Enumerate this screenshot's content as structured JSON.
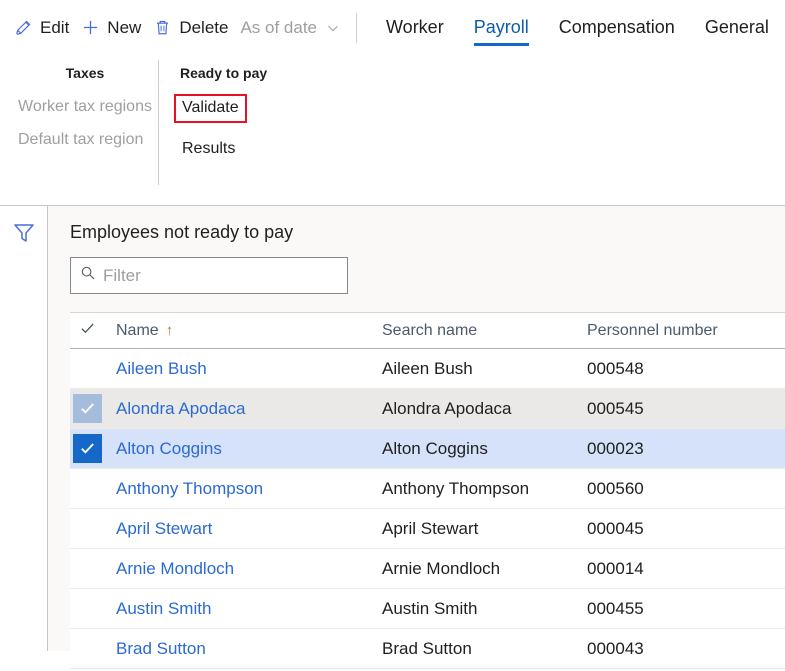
{
  "actionpane": {
    "commands": [
      {
        "label": "Edit",
        "icon": "pencil-icon",
        "disabled": false
      },
      {
        "label": "New",
        "icon": "plus-icon",
        "disabled": false
      },
      {
        "label": "Delete",
        "icon": "trash-icon",
        "disabled": false
      },
      {
        "label": "As of date",
        "icon": "chevron-down-icon",
        "disabled": true
      }
    ],
    "tabs": [
      {
        "label": "Worker",
        "active": false
      },
      {
        "label": "Payroll",
        "active": true
      },
      {
        "label": "Compensation",
        "active": false
      },
      {
        "label": "General",
        "active": false
      }
    ]
  },
  "ribbon": {
    "groups": [
      {
        "title": "Taxes",
        "items": [
          {
            "label": "Worker tax regions",
            "disabled": true,
            "highlighted": false
          },
          {
            "label": "Default tax region",
            "disabled": true,
            "highlighted": false
          }
        ]
      },
      {
        "title": "Ready to pay",
        "items": [
          {
            "label": "Validate",
            "disabled": false,
            "highlighted": true
          },
          {
            "label": "Results",
            "disabled": false,
            "highlighted": false
          }
        ]
      }
    ]
  },
  "filter_rail": {
    "funnel_icon": "filter-funnel-icon"
  },
  "panel": {
    "title": "Employees not ready to pay",
    "filter": {
      "placeholder": "Filter",
      "value": "",
      "icon": "search-icon"
    },
    "grid": {
      "columns": [
        {
          "key": "check",
          "label": ""
        },
        {
          "key": "name",
          "label": "Name",
          "sort": "ascending",
          "sort_glyph": "↑"
        },
        {
          "key": "search",
          "label": "Search name"
        },
        {
          "key": "pers",
          "label": "Personnel number"
        }
      ],
      "rows": [
        {
          "name": "Aileen Bush",
          "search": "Aileen Bush",
          "pers": "000548",
          "selection": "none"
        },
        {
          "name": "Alondra Apodaca",
          "search": "Alondra Apodaca",
          "pers": "000545",
          "selection": "soft"
        },
        {
          "name": "Alton Coggins",
          "search": "Alton Coggins",
          "pers": "000023",
          "selection": "hard"
        },
        {
          "name": "Anthony Thompson",
          "search": "Anthony Thompson",
          "pers": "000560",
          "selection": "none"
        },
        {
          "name": "April Stewart",
          "search": "April Stewart",
          "pers": "000045",
          "selection": "none"
        },
        {
          "name": "Arnie Mondloch",
          "search": "Arnie Mondloch",
          "pers": "000014",
          "selection": "none"
        },
        {
          "name": "Austin Smith",
          "search": "Austin Smith",
          "pers": "000455",
          "selection": "none"
        },
        {
          "name": "Brad Sutton",
          "search": "Brad Sutton",
          "pers": "000043",
          "selection": "none"
        }
      ]
    }
  },
  "colors": {
    "accent_blue": "#1567c8",
    "link_blue": "#2b6ad0",
    "icon_blue": "#4a6fd4",
    "highlight_red": "#e81123",
    "panel_bg": "#faf9f8",
    "row_soft_select": "#eae9e8",
    "row_hard_select": "#d6e2f9",
    "disabled_text": "#a19f9d",
    "sort_arrow": "#b7793a"
  }
}
